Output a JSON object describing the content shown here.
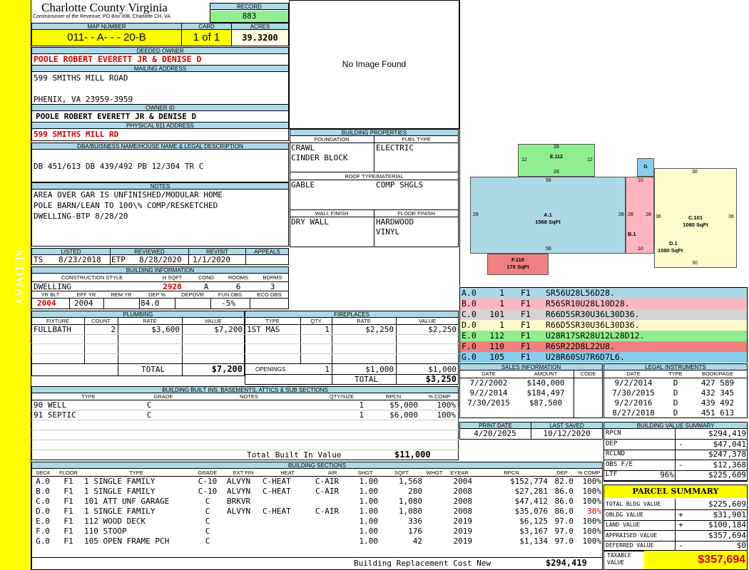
{
  "header": {
    "county": "Charlotte County Virginia",
    "commissioner": "Commissioner of the Revenue, PO Box 308, Charlotte CH, VA",
    "record_label": "RECORD",
    "record": "883",
    "map_number_label": "MAP NUMBER",
    "map_number": "011- - A- - - 20-B",
    "card_label": "CARD",
    "card": "1 of 1",
    "acres_label": "ACRES",
    "acres": "39.3200"
  },
  "sidebar": {
    "label": "MIDWAY",
    "color": "#ffff00"
  },
  "owner": {
    "deeded_label": "DEEDED OWNER",
    "deeded": "POOLE ROBERT EVERETT JR & DENISE D",
    "mailing_label": "MAILING ADDRESS",
    "mailing_line1": "599 SMITHS MILL ROAD",
    "mailing_line2": "PHENIX, VA 23959-3959",
    "owner_id_label": "OWNER ID",
    "owner_id": "POOLE ROBERT EVERETT JR & DENISE D",
    "physical_label": "PHYSICAL 911 ADDRESS",
    "physical": "599 SMITHS MILL RD",
    "dba_label": "DBA/BUISNESS NAME/HOUSE NAME & LEGAL DESCRIPTION",
    "dba": "DB 451/613 DB 439/492 PB 12/304 TR C",
    "notes_label": "NOTES",
    "notes": [
      "AREA OVER GAR IS UNFINISHED/MODULAR HOME",
      "POLE BARN/LEAN TO 100\\% COMP/RESKETCHED",
      "DWELLING-BTP 8/28/20"
    ]
  },
  "image": {
    "text": "No Image Found"
  },
  "dates": {
    "listed_label": "LISTED",
    "listed_by": "TS",
    "listed": "8/23/2018",
    "reviewed_label": "REVIEWED",
    "reviewed_by": "ETP",
    "reviewed": "8/28/2020",
    "revisit_label": "REVISIT",
    "revisit": "1/1/2020",
    "appeals_label": "APPEALS"
  },
  "building_info": {
    "title": "BUILDING INFORMATION",
    "style_label": "CONSTRUCTION STYLE",
    "style": "DWELLING",
    "hsqft_label": "H SQFT",
    "hsqft": "2928",
    "cond_label": "COND",
    "cond": "A",
    "rooms_label": "ROOMS",
    "rooms": "6",
    "bdrms_label": "BDRMS",
    "bdrms": "3",
    "yrblt_label": "YR BLT",
    "yrblt": "2004",
    "effyr_label": "EFF YR",
    "effyr": "2004",
    "remyr_label": "REM YR",
    "dep_label": "DEP %",
    "dep": "84.0",
    "depovr_label": "DEPOVR",
    "funobs_label": "FUN OBS",
    "funobs": "-5%",
    "ecoobs_label": "ECO OBS"
  },
  "building_props": {
    "title": "BUILDING PROPERTIES",
    "foundation_label": "FOUNDATION",
    "foundation": [
      "CRAWL",
      "CINDER BLOCK"
    ],
    "fuel_label": "FUEL TYPE",
    "fuel": "ELECTRIC",
    "roof_label": "ROOF TYPE/MATERIAL",
    "roof_type": "GABLE",
    "roof_material": "COMP SHGLS",
    "wall_label": "WALL FINISH",
    "wall": "DRY WALL",
    "floor_label": "FLOOR FINISH",
    "floor": [
      "HARDWOOD",
      "VINYL"
    ]
  },
  "sketch": {
    "sections": [
      {
        "id": "A.1",
        "area": "1568 SqFt",
        "color": "#add8e6"
      },
      {
        "id": "B.1",
        "area": "",
        "color": "#ffb6c1"
      },
      {
        "id": "C.101",
        "area": "1080 SqFt",
        "color": "#fffacd"
      },
      {
        "id": "D.1",
        "area": "1080 SqFt",
        "color": "#fffacd"
      },
      {
        "id": "E.112",
        "area": "",
        "color": "#90ee90"
      },
      {
        "id": "F.110",
        "area": "176 SqFt",
        "color": "#f08080"
      },
      {
        "id": "G",
        "area": "",
        "color": "#87ceeb"
      }
    ],
    "dims": {
      "e_top": "28",
      "e_left": "12",
      "e_right": "12",
      "e_bottom": "28",
      "a_top": "56",
      "a_left": "28",
      "a_right": "28",
      "a_bottom": "56",
      "b_top": "10",
      "b_left": "28",
      "b_right": "28",
      "b_bottom": "10",
      "c_top": "30",
      "c_left": "36",
      "c_right": "36",
      "c_bottom": "30"
    }
  },
  "vectors": [
    {
      "sec": "A.0",
      "num": "1",
      "floor": "F1",
      "code": "SR56U28L56D28.",
      "color": "#add8e6"
    },
    {
      "sec": "B.0",
      "num": "1",
      "floor": "F1",
      "code": "R56SR10U28L10D28.",
      "color": "#ffb6c1"
    },
    {
      "sec": "C.0",
      "num": "101",
      "floor": "F1",
      "code": "R66D5SR30U36L30D36.",
      "color": "#d3d3d3"
    },
    {
      "sec": "D.0",
      "num": "1",
      "floor": "F1",
      "code": "R66D5SR30U36L30D36.",
      "color": "#fffacd"
    },
    {
      "sec": "E.0",
      "num": "112",
      "floor": "F1",
      "code": "U28R17SR28U12L28D12.",
      "color": "#90ee90"
    },
    {
      "sec": "F.0",
      "num": "110",
      "floor": "F1",
      "code": "R6SR22D8L22U8.",
      "color": "#f08080"
    },
    {
      "sec": "G.0",
      "num": "105",
      "floor": "F1",
      "code": "U28R60SU7R6D7L6.",
      "color": "#87ceeb"
    }
  ],
  "plumbing": {
    "title": "PLUMBING",
    "headers": [
      "FIXTURE",
      "COUNT",
      "RATE",
      "VALUE"
    ],
    "rows": [
      [
        "FULLBATH",
        "2",
        "$3,600",
        "$7,200"
      ]
    ],
    "total_label": "TOTAL",
    "total": "$7,200"
  },
  "fireplaces": {
    "title": "FIREPLACES",
    "headers": [
      "TYPE",
      "QTY",
      "RATE",
      "VALUE"
    ],
    "rows": [
      [
        "1ST MAS",
        "1",
        "$2,250",
        "$2,250"
      ]
    ],
    "openings_label": "OPENINGS",
    "openings_qty": "1",
    "openings_rate": "$1,000",
    "openings_value": "$1,000",
    "total_label": "TOTAL",
    "total": "$3,250"
  },
  "sales": {
    "title": "SALES INFORMATION",
    "headers": [
      "DATE",
      "AMOUNT",
      "CODE"
    ],
    "rows": [
      [
        "7/2/2002",
        "$140,000",
        ""
      ],
      [
        "9/2/2014",
        "$184,497",
        ""
      ],
      [
        "7/30/2015",
        "$87,500",
        ""
      ]
    ]
  },
  "legal": {
    "title": "LEGAL INSTRUMENTS",
    "headers": [
      "DATE",
      "TYPE",
      "BOOK/PAGE"
    ],
    "rows": [
      [
        "9/2/2014",
        "D",
        "427 589"
      ],
      [
        "7/30/2015",
        "D",
        "432 345"
      ],
      [
        "9/2/2016",
        "D",
        "439 492"
      ],
      [
        "8/27/2018",
        "D",
        "451 613"
      ]
    ]
  },
  "print": {
    "print_label": "PRINT DATE",
    "print": "4/20/2025",
    "saved_label": "LAST SAVED",
    "saved": "10/12/2020"
  },
  "builtins": {
    "title": "BUILDING BUILT INS, BASEMENTS, ATTICS & SUB SECTIONS",
    "headers": [
      "TYPE",
      "GRADE",
      "NOTES",
      "QTY/SIZE",
      "RPCN",
      "% COMP"
    ],
    "rows": [
      [
        "90 WELL",
        "C",
        "",
        "1",
        "$5,000",
        "100%"
      ],
      [
        "91 SEPTIC",
        "C",
        "",
        "1",
        "$6,000",
        "100%"
      ]
    ],
    "total_label": "Total Built In Value",
    "total": "$11,000"
  },
  "value_summary": {
    "title": "BUILDING VALUE SUMMARY",
    "rows": [
      {
        "label": "RPCN",
        "sign": "",
        "pct": "",
        "value": "$294,419"
      },
      {
        "label": "DEP",
        "sign": "-",
        "pct": "",
        "value": "$47,041"
      },
      {
        "label": "RCLND",
        "sign": "",
        "pct": "",
        "value": "$247,378"
      },
      {
        "label": "OBS F/E",
        "sign": "-",
        "pct": "",
        "value": "$12,368"
      },
      {
        "label": "LTF",
        "sign": "",
        "pct": "96%",
        "value": "$225,609"
      }
    ]
  },
  "parcel": {
    "title": "PARCEL SUMMARY",
    "rows": [
      {
        "label": "TOTAL BLDG VALUE",
        "sign": "",
        "value": "$225,609"
      },
      {
        "label": "OBLDG VALUE",
        "sign": "+",
        "value": "$31,901"
      },
      {
        "label": "LAND VALUE",
        "sign": "+",
        "value": "$100,184"
      },
      {
        "label": "APPRAISED VALUE",
        "sign": "",
        "value": "$357,694"
      },
      {
        "label": "DEFERRED VALUE",
        "sign": "-",
        "value": "$0"
      }
    ],
    "taxable_label": "TAXABLE VALUE",
    "taxable": "$357,694"
  },
  "sections": {
    "title": "BUILDING SECTIONS",
    "headers": [
      "SEC#",
      "FLOOR",
      "TYPE",
      "GRADE",
      "EXT FIN",
      "HEAT",
      "AIR",
      "SHGT",
      "SQFT",
      "WHGT",
      "EYEAR",
      "RPCN",
      "DEP",
      "% COMP"
    ],
    "rows": [
      [
        "A.0",
        "F1",
        "1 SINGLE FAMILY",
        "C-10",
        "ALVYN",
        "C-HEAT",
        "C-AIR",
        "1.00",
        "1,568",
        "",
        "2004",
        "$152,774",
        "82.0",
        "100%"
      ],
      [
        "B.0",
        "F1",
        "1 SINGLE FAMILY",
        "C-10",
        "ALVYN",
        "C-HEAT",
        "C-AIR",
        "1.00",
        "280",
        "",
        "2008",
        "$27,281",
        "86.0",
        "100%"
      ],
      [
        "C.0",
        "F1",
        "101 ATT UNF GARAGE",
        "C",
        "BRKVR",
        "",
        "",
        "1.00",
        "1,080",
        "",
        "2008",
        "$47,412",
        "86.0",
        "100%"
      ],
      [
        "D.0",
        "F1",
        "1 SINGLE FAMILY",
        "C",
        "ALVYN",
        "C-HEAT",
        "C-AIR",
        "1.00",
        "1,080",
        "",
        "2008",
        "$35,076",
        "86.0",
        "30%"
      ],
      [
        "E.0",
        "F1",
        "112 WOOD DECK",
        "C",
        "",
        "",
        "",
        "1.00",
        "336",
        "",
        "2019",
        "$6,125",
        "97.0",
        "100%"
      ],
      [
        "F.0",
        "F1",
        "110 STOOP",
        "C",
        "",
        "",
        "",
        "1.00",
        "176",
        "",
        "2019",
        "$3,167",
        "97.0",
        "100%"
      ],
      [
        "G.0",
        "F1",
        "105 OPEN FRAME PCH",
        "C",
        "",
        "",
        "",
        "1.00",
        "42",
        "",
        "2019",
        "$1,134",
        "97.0",
        "100%"
      ]
    ],
    "total_label": "Building Replacement Cost New",
    "total": "$294,419"
  }
}
